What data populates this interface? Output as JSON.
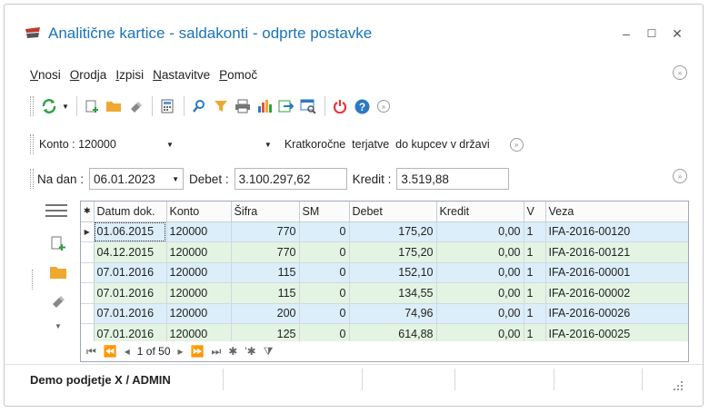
{
  "window": {
    "title": "Analitične kartice - saldakonti - odprte postavke",
    "minimize": "–",
    "maximize": "☐",
    "close": "✕"
  },
  "menu": {
    "items": [
      "Vnosi",
      "Orodja",
      "Izpisi",
      "Nastavitve",
      "Pomoč"
    ]
  },
  "toolbar": {
    "icons": [
      "refresh-icon",
      "new-record-icon",
      "open-folder-icon",
      "eraser-icon",
      "calculator-icon",
      "search-icon",
      "filter-icon",
      "print-icon",
      "chart-icon",
      "export-icon",
      "preview-icon",
      "power-icon",
      "help-icon"
    ]
  },
  "konto": {
    "label": "Konto : 120000",
    "description": "Kratkoročne  terjatve  do kupcev v državi"
  },
  "filters": {
    "na_dan_label": "Na dan :",
    "na_dan_value": "06.01.2023",
    "debet_label": "Debet :",
    "debet_value": "3.100.297,62",
    "kredit_label": "Kredit :",
    "kredit_value": "3.519,88"
  },
  "grid": {
    "columns": [
      "Datum dok.",
      "Konto",
      "Šifra",
      "SM",
      "Debet",
      "Kredit",
      "V",
      "Veza"
    ],
    "header_indicator": "✱",
    "rows": [
      [
        "01.06.2015",
        "120000",
        "770",
        "0",
        "175,20",
        "0,00",
        "1",
        "IFA-2016-00120"
      ],
      [
        "04.12.2015",
        "120000",
        "770",
        "0",
        "175,20",
        "0,00",
        "1",
        "IFA-2016-00121"
      ],
      [
        "07.01.2016",
        "120000",
        "115",
        "0",
        "152,10",
        "0,00",
        "1",
        "IFA-2016-00001"
      ],
      [
        "07.01.2016",
        "120000",
        "115",
        "0",
        "134,55",
        "0,00",
        "1",
        "IFA-2016-00002"
      ],
      [
        "07.01.2016",
        "120000",
        "200",
        "0",
        "74,96",
        "0,00",
        "1",
        "IFA-2016-00026"
      ],
      [
        "07.01.2016",
        "120000",
        "125",
        "0",
        "614,88",
        "0,00",
        "1",
        "IFA-2016-00025"
      ]
    ],
    "row_colors": [
      "blue",
      "green",
      "blue",
      "green",
      "blue",
      "green"
    ],
    "navigator": {
      "position": "1 of 50",
      "first": "⏮",
      "prev_page": "⏪",
      "prev": "◂",
      "next": "▸",
      "next_page": "⏩",
      "last": "⏭",
      "append": "✱",
      "edit": "'✱",
      "filter": "⧩"
    }
  },
  "status": {
    "text": "Demo podjetje X / ADMIN"
  },
  "colors": {
    "title": "#1a73b8",
    "row_blue": "#dbeefa",
    "row_green": "#e3f4e3"
  }
}
